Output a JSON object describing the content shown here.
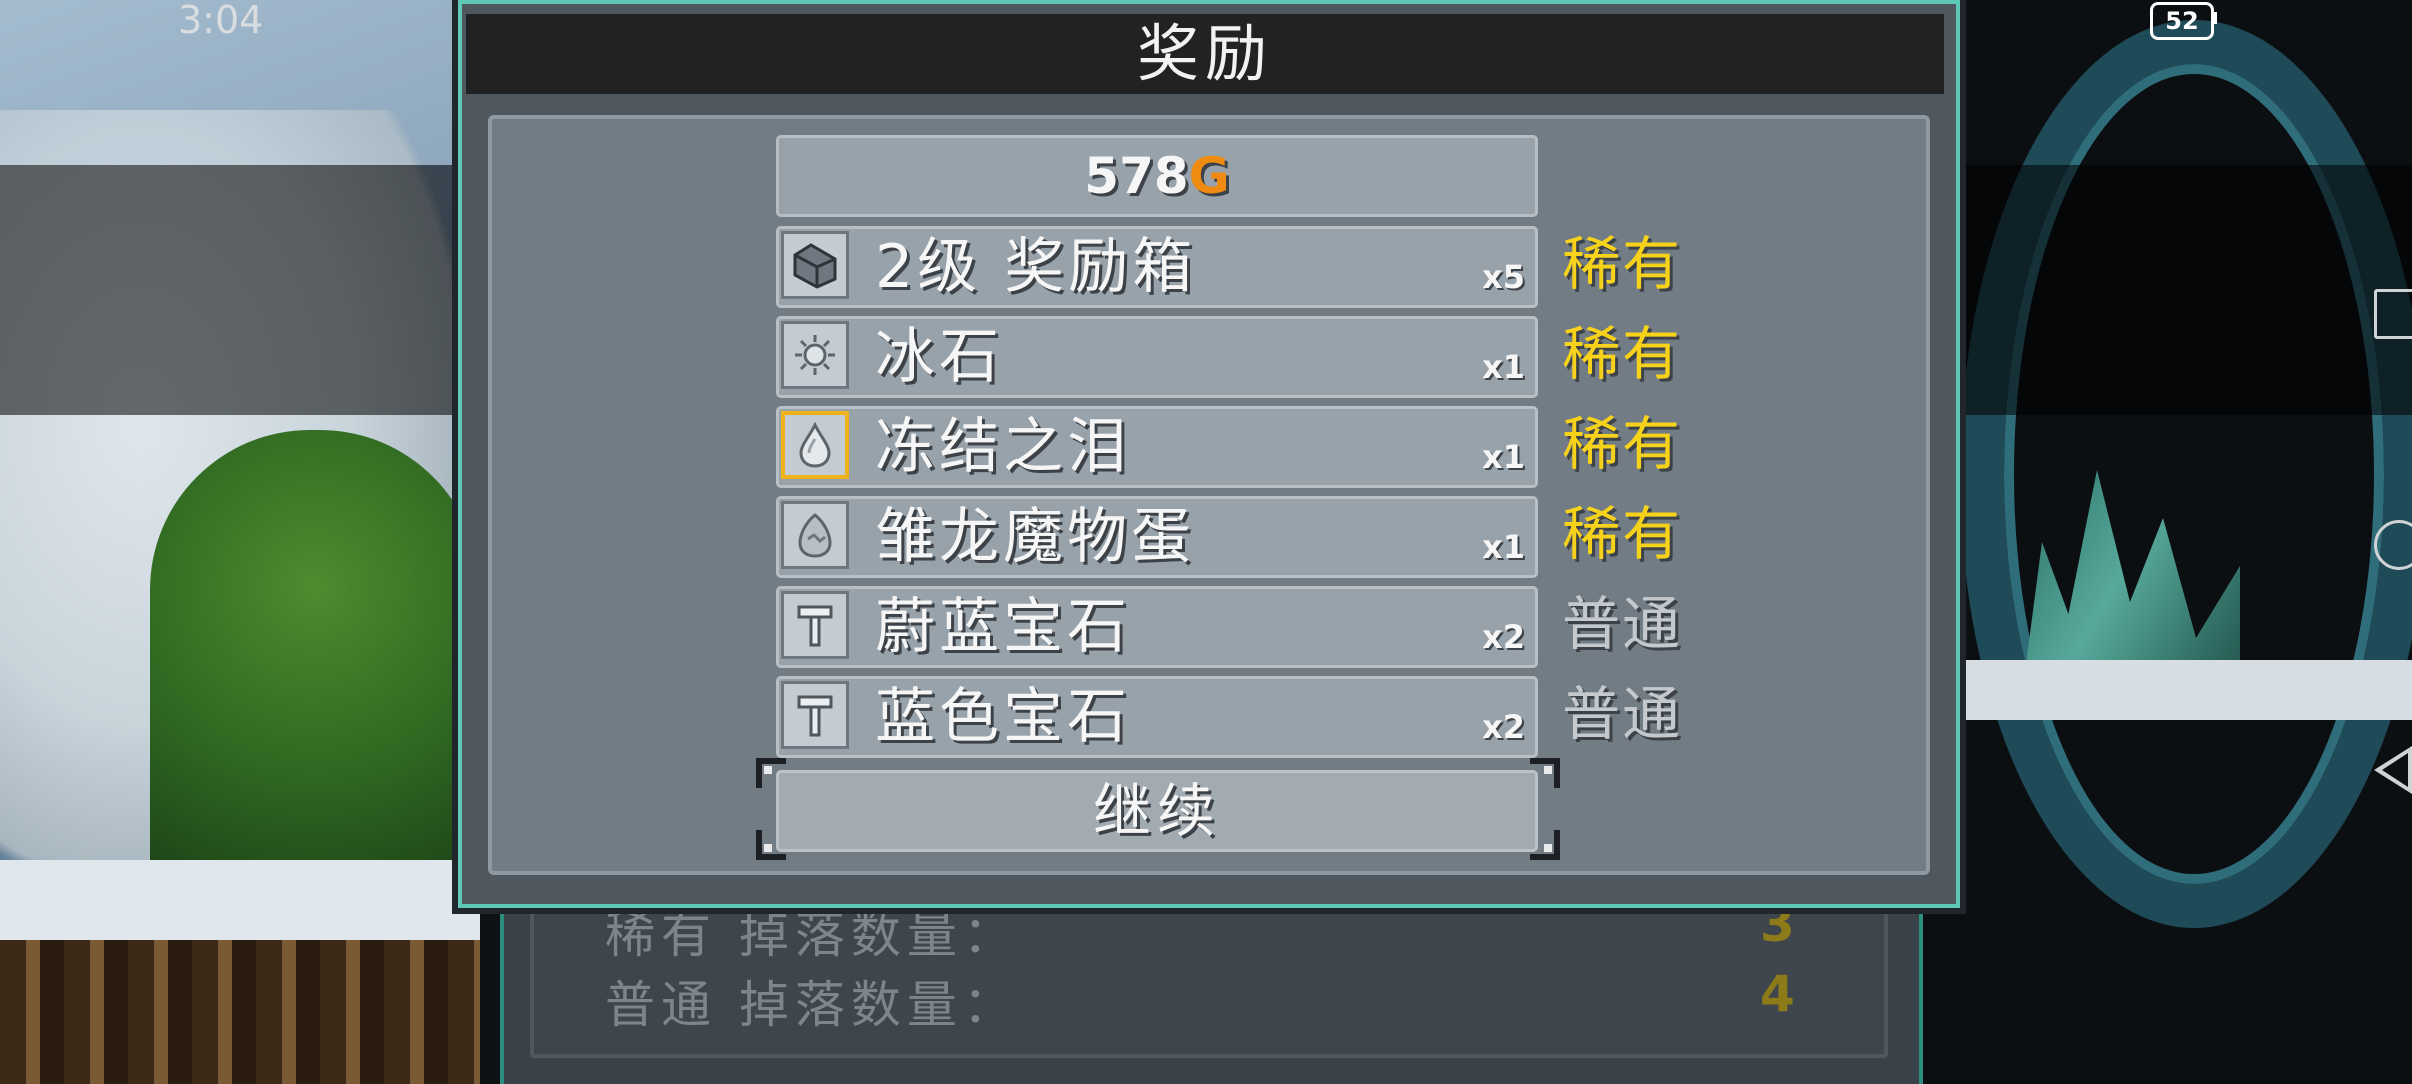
{
  "status_bar": {
    "time": "3:04",
    "battery": "52"
  },
  "modal": {
    "title": "奖励",
    "gold_amount": "578",
    "gold_unit": "G",
    "items": [
      {
        "name": "2级 奖励箱",
        "qty": "x5",
        "rarity": "稀有",
        "rarity_color": "#f7d21a",
        "icon": "chest-icon"
      },
      {
        "name": "冰石",
        "qty": "x1",
        "rarity": "稀有",
        "rarity_color": "#f7d21a",
        "icon": "ice-stone-icon"
      },
      {
        "name": "冻结之泪",
        "qty": "x1",
        "rarity": "稀有",
        "rarity_color": "#f7d21a",
        "icon": "frozen-tear-icon",
        "selected": true
      },
      {
        "name": "雏龙魔物蛋",
        "qty": "x1",
        "rarity": "稀有",
        "rarity_color": "#f7d21a",
        "icon": "egg-icon"
      },
      {
        "name": "蔚蓝宝石",
        "qty": "x2",
        "rarity": "普通",
        "rarity_color": "#c3c9cd",
        "icon": "gem-icon"
      },
      {
        "name": "蓝色宝石",
        "qty": "x2",
        "rarity": "普通",
        "rarity_color": "#c3c9cd",
        "icon": "gem-icon"
      }
    ],
    "continue_label": "继续"
  },
  "underlying": {
    "rare_drops_label": "稀有 掉落数量：",
    "rare_drops_value": "3",
    "common_drops_label": "普通 掉落数量：",
    "common_drops_value": "4"
  }
}
